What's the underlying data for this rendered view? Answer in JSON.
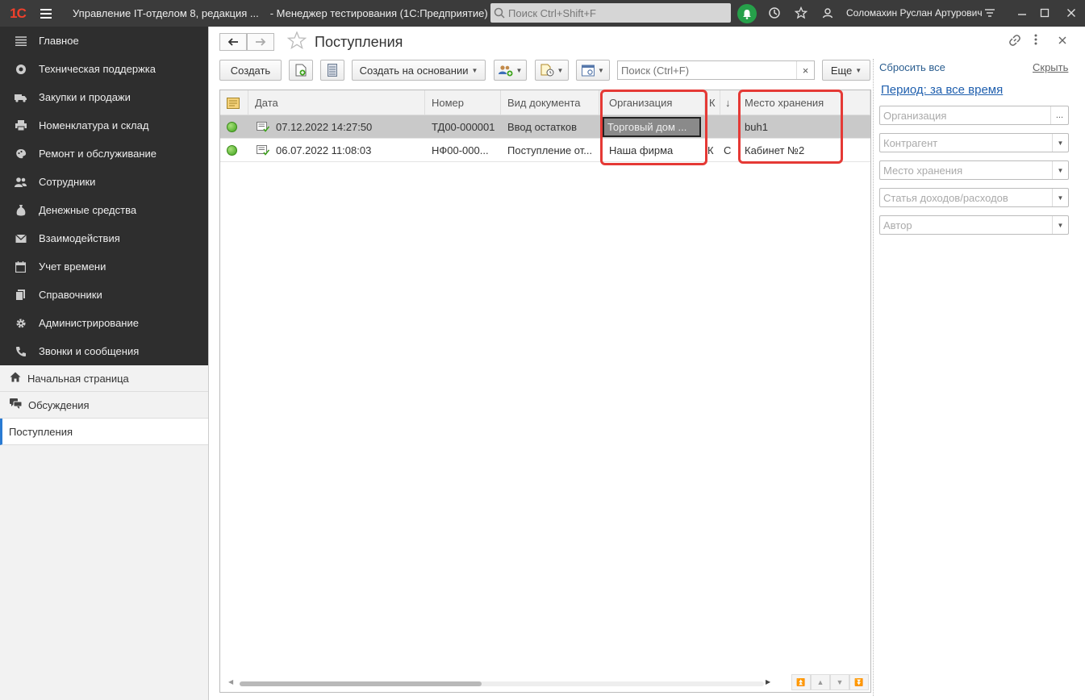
{
  "titlebar": {
    "logo": "1С",
    "title": "Управление IT-отделом 8, редакция ...",
    "subtitle": "- Менеджер тестирования (1С:Предприятие)",
    "search_placeholder": "Поиск Ctrl+Shift+F",
    "user": "Соломахин Руслан Артурович"
  },
  "sidebar": {
    "sections": [
      {
        "label": "Главное",
        "icon": "menu-lines-icon"
      },
      {
        "label": "Техническая поддержка",
        "icon": "lifebuoy-icon"
      },
      {
        "label": "Закупки и продажи",
        "icon": "truck-icon"
      },
      {
        "label": "Номенклатура и склад",
        "icon": "printer-icon"
      },
      {
        "label": "Ремонт и обслуживание",
        "icon": "palette-icon"
      },
      {
        "label": "Сотрудники",
        "icon": "people-icon"
      },
      {
        "label": "Денежные средства",
        "icon": "money-bag-icon"
      },
      {
        "label": "Взаимодействия",
        "icon": "envelope-icon"
      },
      {
        "label": "Учет времени",
        "icon": "calendar-icon"
      },
      {
        "label": "Справочники",
        "icon": "books-icon"
      },
      {
        "label": "Администрирование",
        "icon": "gear-icon"
      },
      {
        "label": "Звонки и сообщения",
        "icon": "phone-icon"
      }
    ],
    "open_windows": [
      {
        "label": "Начальная страница",
        "icon": "home-icon"
      },
      {
        "label": "Обсуждения",
        "icon": "chat-icon"
      },
      {
        "label": "Поступления",
        "active": true
      }
    ]
  },
  "form": {
    "title": "Поступления",
    "toolbar": {
      "create": "Создать",
      "create_based_on": "Создать на основании",
      "search_placeholder": "Поиск (Ctrl+F)",
      "more": "Еще"
    },
    "columns": [
      "Дата",
      "Номер",
      "Вид документа",
      "Организация",
      "К",
      "Место хранения"
    ],
    "sort_indicator": "↓",
    "rows": [
      {
        "date": "07.12.2022 14:27:50",
        "number": "ТД00-000001",
        "doc_type": "Ввод остатков",
        "org": "Торговый дом ...",
        "k": "",
        "k2": "",
        "storage": "buh1",
        "selected": true
      },
      {
        "date": "06.07.2022 11:08:03",
        "number": "НФ00-000...",
        "doc_type": "Поступление от...",
        "org": "Наша фирма",
        "k": "К",
        "k2": "С",
        "storage": "Кабинет №2",
        "selected": false
      }
    ]
  },
  "filters": {
    "reset": "Сбросить все",
    "hide": "Скрыть",
    "period": "Период: за все время",
    "fields": [
      {
        "placeholder": "Организация",
        "button": "..."
      },
      {
        "placeholder": "Контрагент",
        "button": "▼"
      },
      {
        "placeholder": "Место хранения",
        "button": "▼"
      },
      {
        "placeholder": "Статья доходов/расходов",
        "button": "▼"
      },
      {
        "placeholder": "Автор",
        "button": "▼"
      }
    ]
  },
  "colors": {
    "titlebar_bg": "#3b3b3b",
    "sidebar_dark": "#2e2e2e",
    "highlight": "#e53935",
    "status_green": "#3ea31c",
    "link": "#2a5d8f"
  }
}
